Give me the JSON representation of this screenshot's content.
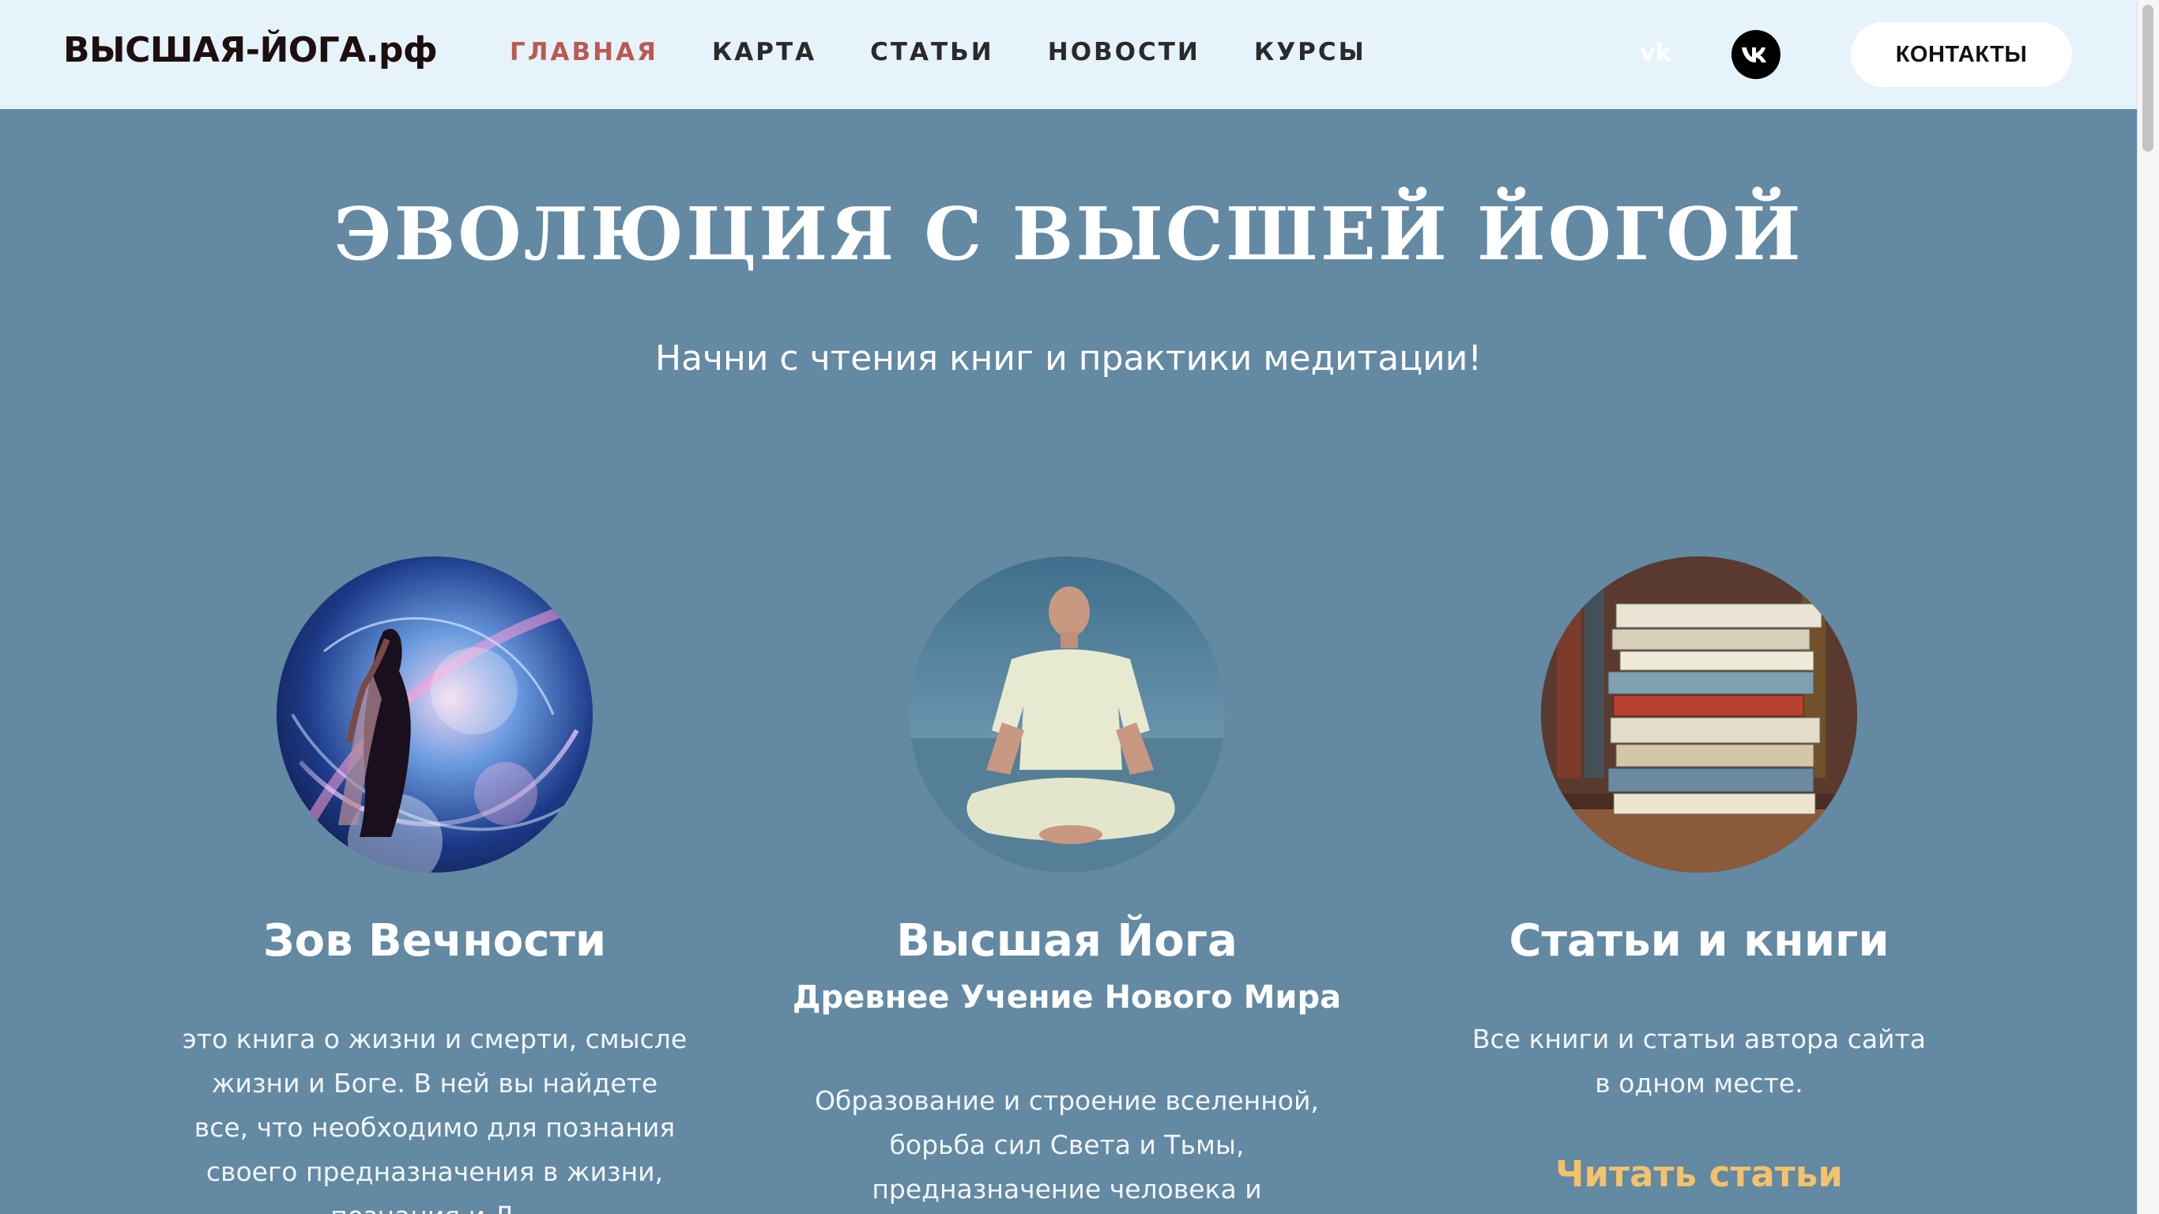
{
  "header": {
    "logo": "ВЫСШАЯ-ЙОГА.рф",
    "nav": [
      {
        "label": "ГЛАВНАЯ",
        "active": true
      },
      {
        "label": "КАРТА",
        "active": false
      },
      {
        "label": "СТАТЬИ",
        "active": false
      },
      {
        "label": "НОВОСТИ",
        "active": false
      },
      {
        "label": "КУРСЫ",
        "active": false
      }
    ],
    "social_icons": [
      "vk-icon",
      "vk-circle-icon"
    ],
    "contacts_label": "КОНТАКТЫ"
  },
  "hero": {
    "title": "Эволюция с Высшей Йогой",
    "subtitle": "Начни с чтения книг и практики медитации!"
  },
  "columns": [
    {
      "image": "cosmic-woman-image",
      "title": "Зов Вечности",
      "text": "это книга о жизни и смерти, смысле жизни и Боге. В ней вы найдете все, что необходимо для познания своего предназначения в жизни, познания и Д..."
    },
    {
      "image": "meditating-man-image",
      "title": "Высшая Йога",
      "subtitle": "Древнее Учение Нового Мира",
      "text": "Образование и строение вселенной, борьба сил Света и Тьмы, предназначение человека и"
    },
    {
      "image": "book-stack-image",
      "title": "Статьи и книги",
      "text": "Все книги и статьи автора сайта в одном месте.",
      "link": "Читать статьи"
    }
  ],
  "colors": {
    "header_bg": "#e6f3fa",
    "page_bg": "#6389a3",
    "active_nav": "#b95a52",
    "link_accent": "#f3c26b"
  }
}
